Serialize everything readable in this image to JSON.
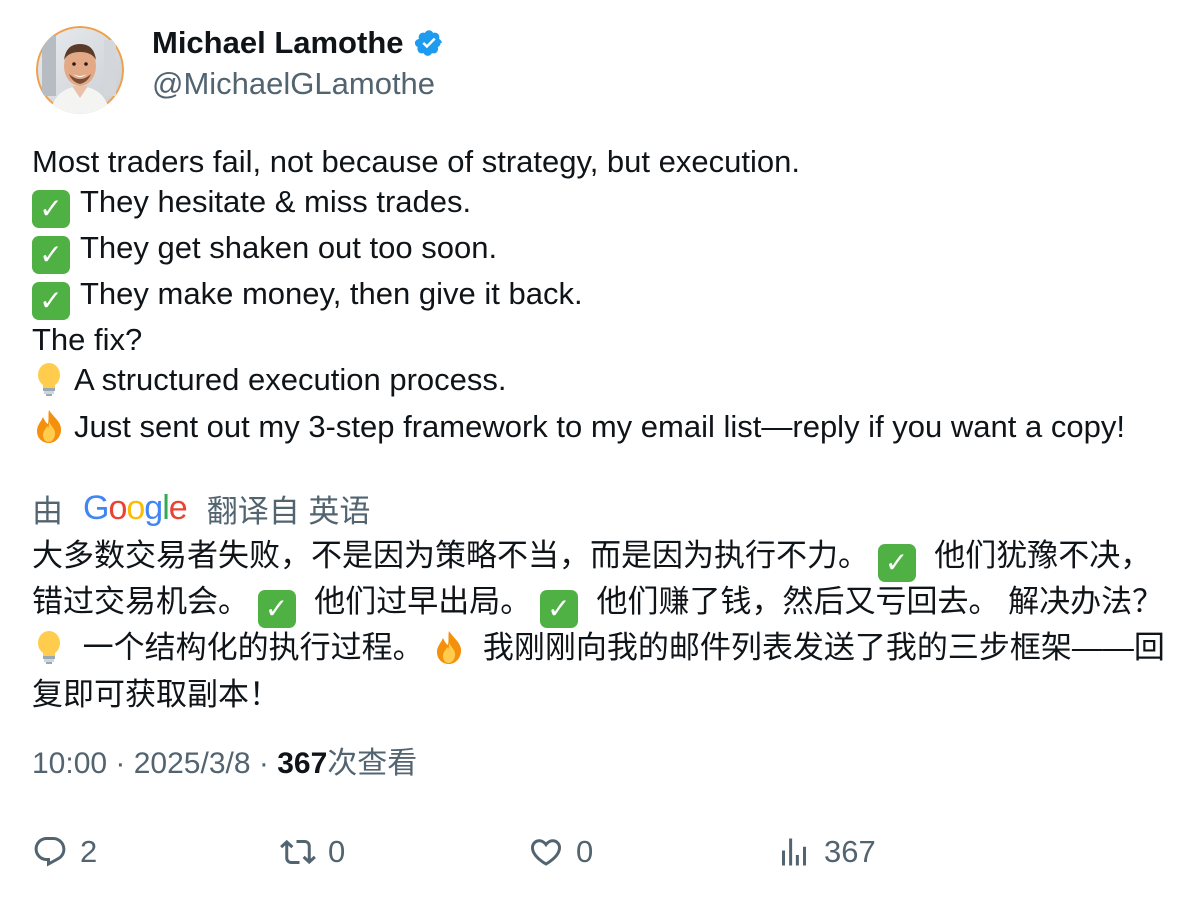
{
  "author": {
    "display_name": "Michael Lamothe",
    "handle": "@MichaelGLamothe",
    "verified": true,
    "verified_color": "#1d9bf0"
  },
  "tweet": {
    "lines": [
      {
        "emoji": "",
        "text": "Most traders fail, not because of strategy, but execution."
      },
      {
        "emoji": "check",
        "text": "They hesitate & miss trades."
      },
      {
        "emoji": "check",
        "text": "They get shaken out too soon."
      },
      {
        "emoji": "check",
        "text": "They make money, then give it back."
      },
      {
        "emoji": "",
        "text": "The fix?"
      },
      {
        "emoji": "bulb",
        "text": "A structured execution process."
      },
      {
        "emoji": "fire",
        "text": "Just sent out my 3-step framework to my email list—reply if you want a copy!"
      }
    ]
  },
  "translation": {
    "prefix": "由",
    "provider": "Google",
    "suffix": "翻译自 英语",
    "segments": [
      {
        "emoji": "",
        "text": "大多数交易者失败，不是因为策略不当，而是因为执行不力。 "
      },
      {
        "emoji": "check",
        "text": " 他们犹豫不决，错过交易机会。 "
      },
      {
        "emoji": "check",
        "text": " 他们过早出局。 "
      },
      {
        "emoji": "check",
        "text": " 他们赚了钱，然后又亏回去。 解决办法？ "
      },
      {
        "emoji": "bulb",
        "text": " 一个结构化的执行过程。 "
      },
      {
        "emoji": "fire",
        "text": " 我刚刚向我的邮件列表发送了我的三步框架——回复即可获取副本！"
      }
    ]
  },
  "meta": {
    "time": "10:00",
    "separator": " · ",
    "date": "2025/3/8",
    "views_count": "367",
    "views_label": "次查看"
  },
  "actions": {
    "replies": "2",
    "retweets": "0",
    "likes": "0",
    "views": "367"
  },
  "colors": {
    "text_primary": "#0f1419",
    "text_secondary": "#536471",
    "check_green": "#4fb043"
  }
}
